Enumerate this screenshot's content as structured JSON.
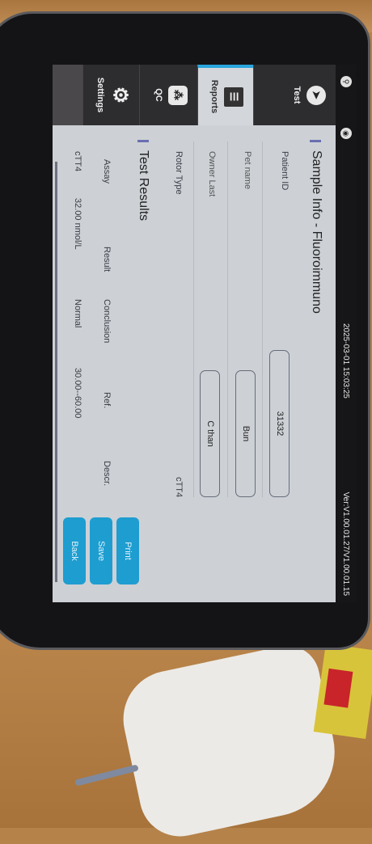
{
  "status_bar": {
    "datetime": "2025-03-01 15:03:25",
    "version": "Ver:V1.00.01.27/V1.00.01.15",
    "icons": [
      "usb-icon",
      "wifi-icon"
    ]
  },
  "nav": {
    "items": [
      {
        "label": "Test",
        "icon": "test-arrow-icon"
      },
      {
        "label": "Reports",
        "icon": "reports-list-icon",
        "selected": true
      },
      {
        "label": "QC",
        "icon": "qc-nodes-icon"
      },
      {
        "label": "Settings",
        "icon": "gear-icon"
      }
    ]
  },
  "sample_info": {
    "title": "Sample Info - Fluoroimmuno",
    "patient_id_label": "Patient ID",
    "patient_id": "31332",
    "pet_name_label": "Pet name",
    "pet_name": "Bun",
    "owner_last_label": "Owner Last",
    "owner_last": "C than",
    "rotor_type_label": "Rotor Type",
    "rotor_type": "cTT4"
  },
  "test_results": {
    "title": "Test Results",
    "columns": [
      "Assay",
      "Result",
      "Conclusion",
      "Ref.",
      "Descr."
    ],
    "rows": [
      {
        "assay": "cTT4",
        "result": "32.00 nmol/L",
        "conclusion": "Normal",
        "ref": "30.00--60.00",
        "descr": ""
      }
    ]
  },
  "buttons": {
    "print": "Print",
    "save": "Save",
    "back": "Back"
  },
  "colors": {
    "accent": "#1e9dd0",
    "nav_bg": "#2d2d30",
    "screen_bg": "#cdd1d6"
  }
}
